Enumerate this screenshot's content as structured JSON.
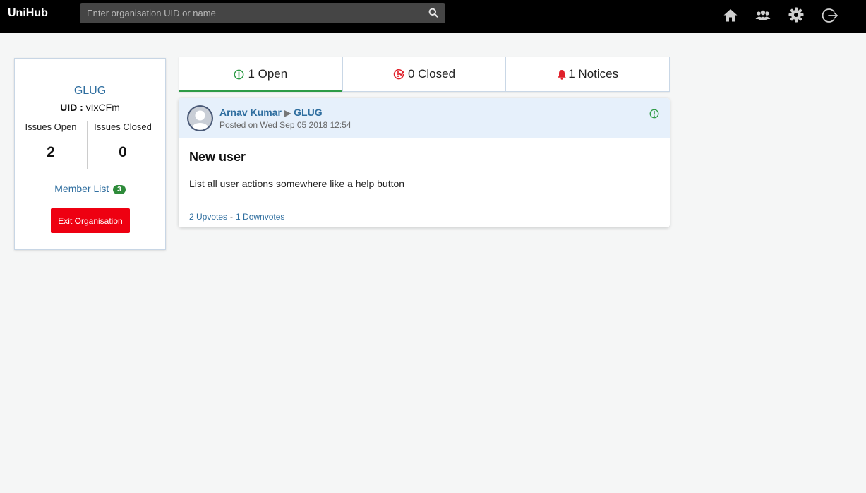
{
  "navbar": {
    "brand": "UniHub",
    "search_placeholder": "Enter organisation UID or name",
    "icons": [
      "home-icon",
      "users-icon",
      "gear-icon",
      "logout-icon"
    ]
  },
  "org": {
    "name": "GLUG",
    "uid_label": "UID :",
    "uid_value": "vIxCFm",
    "issues_open_label": "Issues Open",
    "issues_open_count": "2",
    "issues_closed_label": "Issues Closed",
    "issues_closed_count": "0",
    "member_list_label": "Member List",
    "member_count": "3",
    "exit_label": "Exit Organisation"
  },
  "tabs": [
    {
      "label": "1 Open",
      "icon": "open-issue-icon",
      "active": true
    },
    {
      "label": "0 Closed",
      "icon": "closed-issue-icon",
      "active": false
    },
    {
      "label": "1 Notices",
      "icon": "bell-icon",
      "active": false
    }
  ],
  "issue": {
    "author": "Arnav Kumar",
    "org": "GLUG",
    "posted": "Posted on Wed Sep 05 2018 12:54",
    "title": "New user",
    "body": "List all user actions somewhere like a help button",
    "upvotes": "2 Upvotes",
    "separator": "-",
    "downvotes": "1 Downvotes"
  },
  "colors": {
    "navbar_bg": "#000000",
    "link": "#2f6e9f",
    "open_green": "#2e9b46",
    "closed_red": "#e0202a",
    "exit_red": "#ee0011",
    "badge_green": "#2e8b3a",
    "issue_header_bg": "#e6f0fb"
  }
}
